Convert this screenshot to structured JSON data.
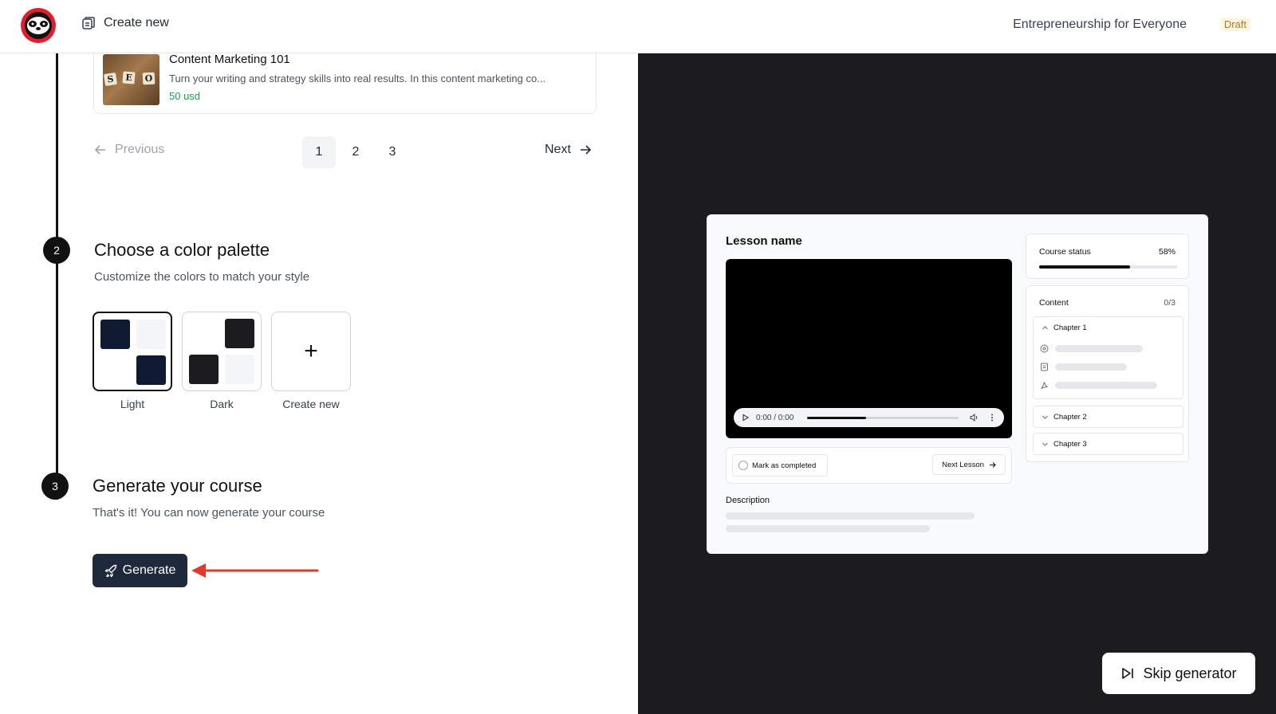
{
  "header": {
    "create_new_label": "Create new",
    "course_title": "Entrepreneurship for Everyone",
    "status_badge": "Draft"
  },
  "course_card": {
    "name": "Content Marketing 101",
    "description": "Turn your writing and strategy skills into real results. In this content marketing co...",
    "price": "50 usd",
    "thumb_letters": [
      "S",
      "E",
      "O"
    ]
  },
  "pagination": {
    "previous_label": "Previous",
    "next_label": "Next",
    "pages": [
      "1",
      "2",
      "3"
    ],
    "active_page": "1"
  },
  "step2": {
    "number": "2",
    "title": "Choose a color palette",
    "subtitle": "Customize the colors to match your style",
    "palettes": [
      {
        "label": "Light",
        "selected": true,
        "colors": [
          "#0f1b33",
          "#f4f5f7"
        ]
      },
      {
        "label": "Dark",
        "selected": false,
        "colors": [
          "#1c1c1e",
          "#f4f5f7"
        ]
      },
      {
        "label": "Create new",
        "selected": false
      }
    ]
  },
  "step3": {
    "number": "3",
    "title": "Generate your course",
    "subtitle": "That's it! You can now generate your course",
    "generate_label": "Generate"
  },
  "preview": {
    "lesson_name": "Lesson name",
    "time": "0:00 / 0:00",
    "playback_progress": 0.39,
    "mark_completed_label": "Mark as completed",
    "next_lesson_label": "Next Lesson",
    "description_label": "Description",
    "course_status_label": "Course status",
    "course_status_pct": "58%",
    "course_status_value": 0.66,
    "content_label": "Content",
    "content_count": "0/3",
    "chapters": [
      "Chapter 1",
      "Chapter 2",
      "Chapter 3"
    ]
  },
  "skip_label": "Skip generator",
  "colors": {
    "accent_dark": "#1e293b",
    "price_green": "#16a34a",
    "draft_text": "#b7791f",
    "arrow_red": "#e03a2f",
    "right_bg": "#1c1c1e"
  }
}
